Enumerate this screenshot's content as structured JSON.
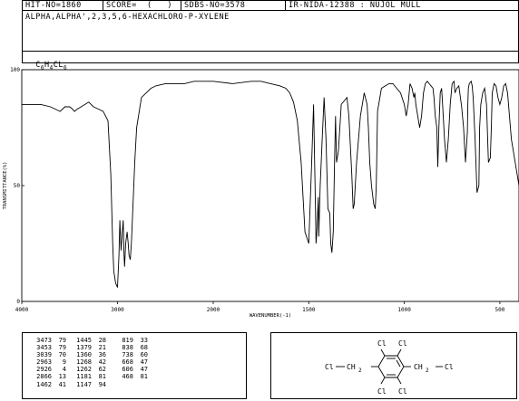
{
  "header": {
    "hit_no": "HIT-NO=1860",
    "score": "SCORE=  (   )",
    "sdbs_no": "SDBS-NO=3578",
    "ir_nida": "IR-NIDA-12388 : NUJOL MULL",
    "compound_name": "ALPHA,ALPHA',2,3,5,6-HEXACHLORO-P-XYLENE",
    "formula_parts": [
      "C",
      "6",
      "H",
      "4",
      "CL",
      "6"
    ]
  },
  "chart_data": {
    "type": "line",
    "xlabel": "WAVENUMBER(-1)",
    "ylabel": "TRANSMITTANCE(%)",
    "xlim": [
      4000,
      500
    ],
    "ylim": [
      0,
      100
    ],
    "x_ticks": [
      "4000",
      "3000",
      "2000",
      "1500",
      "1000",
      "500"
    ],
    "y_ticks": [
      "100",
      "50",
      "0"
    ],
    "series": [
      {
        "x": [
          4000,
          3800,
          3700,
          3650,
          3600,
          3550,
          3500,
          3470,
          3450,
          3420,
          3380,
          3300,
          3250,
          3200,
          3150,
          3100,
          3070,
          3050,
          3039,
          3020,
          3000,
          2985,
          2975,
          2963,
          2950,
          2940,
          2932,
          2926,
          2915,
          2900,
          2888,
          2880,
          2866,
          2855,
          2840,
          2820,
          2800,
          2750,
          2700,
          2650,
          2600,
          2500,
          2400,
          2300,
          2200,
          2100,
          2000,
          1900,
          1800,
          1750,
          1700,
          1650,
          1620,
          1600,
          1580,
          1560,
          1540,
          1530,
          1520,
          1500,
          1485,
          1475,
          1465,
          1462,
          1458,
          1450,
          1448,
          1440,
          1430,
          1420,
          1410,
          1400,
          1390,
          1385,
          1379,
          1372,
          1365,
          1360,
          1355,
          1345,
          1330,
          1300,
          1290,
          1275,
          1268,
          1262,
          1250,
          1230,
          1220,
          1210,
          1195,
          1188,
          1181,
          1172,
          1160,
          1152,
          1147,
          1140,
          1120,
          1100,
          1080,
          1060,
          1040,
          1020,
          1000,
          990,
          980,
          970,
          960,
          950,
          945,
          940,
          930,
          920,
          910,
          900,
          890,
          880,
          870,
          860,
          850,
          845,
          838,
          830,
          825,
          819,
          812,
          805,
          800,
          790,
          780,
          770,
          760,
          750,
          740,
          738,
          735,
          725,
          715,
          700,
          690,
          680,
          670,
          668,
          665,
          660,
          650,
          645,
          640,
          630,
          620,
          610,
          606,
          600,
          590,
          580,
          570,
          560,
          550,
          545,
          540,
          530,
          520,
          510,
          500,
          490,
          480,
          470,
          460,
          450,
          440,
          420,
          400
        ],
        "y": [
          85,
          85,
          84,
          83,
          82,
          84,
          84,
          83,
          82,
          83,
          84,
          86,
          84,
          83,
          82,
          78,
          55,
          25,
          13,
          8,
          6,
          20,
          35,
          22,
          30,
          35,
          20,
          15,
          25,
          30,
          25,
          20,
          18,
          25,
          40,
          60,
          75,
          88,
          90,
          92,
          93,
          94,
          94,
          94,
          95,
          95,
          95,
          94,
          95,
          95,
          94,
          93,
          92,
          90,
          86,
          78,
          60,
          45,
          30,
          25,
          60,
          85,
          40,
          25,
          30,
          45,
          28,
          50,
          70,
          88,
          70,
          40,
          38,
          25,
          21,
          30,
          60,
          80,
          60,
          65,
          85,
          88,
          80,
          55,
          40,
          42,
          60,
          80,
          85,
          90,
          85,
          75,
          60,
          50,
          42,
          40,
          50,
          82,
          92,
          93,
          94,
          94,
          92,
          90,
          85,
          80,
          85,
          94,
          92,
          88,
          90,
          85,
          80,
          75,
          80,
          90,
          94,
          95,
          94,
          93,
          92,
          88,
          80,
          75,
          58,
          75,
          90,
          92,
          85,
          70,
          60,
          70,
          85,
          94,
          95,
          93,
          90,
          92,
          93,
          84,
          75,
          60,
          73,
          85,
          92,
          94,
          95,
          93,
          88,
          70,
          47,
          50,
          75,
          85,
          90,
          92,
          85,
          60,
          62,
          75,
          90,
          94,
          93,
          88,
          85,
          88,
          93,
          94,
          90,
          80,
          70,
          60,
          50
        ]
      }
    ],
    "grid": false
  },
  "peak_table": [
    [
      "3473",
      "79",
      "1445",
      "28",
      "819",
      "33"
    ],
    [
      "3453",
      "79",
      "1379",
      "21",
      "838",
      "68"
    ],
    [
      "3039",
      "70",
      "1360",
      "36",
      "738",
      "60"
    ],
    [
      "2963",
      "9",
      "1268",
      "42",
      "668",
      "47"
    ],
    [
      "2926",
      "4",
      "1262",
      "62",
      "606",
      "47"
    ],
    [
      "2866",
      "13",
      "1181",
      "81",
      "468",
      "81"
    ],
    [
      "1462",
      "41",
      "1147",
      "94",
      "",
      ""
    ]
  ],
  "structure": {
    "cl_top_left": "Cl",
    "cl_top_right": "Cl",
    "cl_bottom_left": "Cl",
    "cl_bottom_right": "Cl",
    "left_group_cl": "Cl",
    "left_group_ch2": "CH",
    "left_group_sub": "2",
    "right_group_ch2": "CH",
    "right_group_sub": "2",
    "right_group_cl": "Cl"
  }
}
